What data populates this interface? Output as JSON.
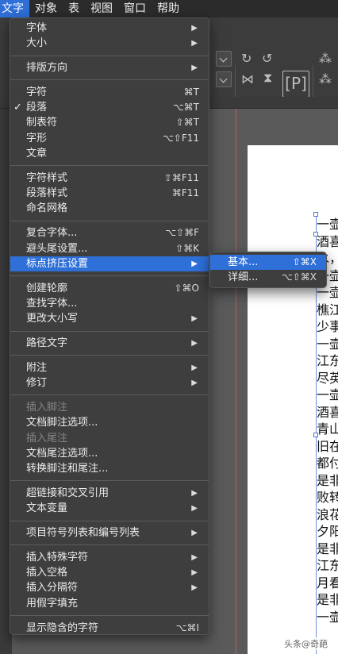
{
  "menubar": {
    "items": [
      {
        "label": "文字",
        "active": true
      },
      {
        "label": "对象",
        "active": false
      },
      {
        "label": "表",
        "active": false
      },
      {
        "label": "视图",
        "active": false
      },
      {
        "label": "窗口",
        "active": false
      },
      {
        "label": "帮助",
        "active": false
      }
    ]
  },
  "toolbar": {
    "bracket_glyph": "[P]"
  },
  "main_menu": {
    "items": {
      "font": {
        "label": "字体",
        "arrow": "▶"
      },
      "size": {
        "label": "大小",
        "arrow": "▶"
      },
      "orientation": {
        "label": "排版方向",
        "arrow": "▶"
      },
      "character": {
        "label": "字符",
        "shortcut": "⌘T"
      },
      "paragraph": {
        "label": "段落",
        "shortcut": "⌥⌘T",
        "check": "✓"
      },
      "tabs": {
        "label": "制表符",
        "shortcut": "⇧⌘T"
      },
      "glyphs": {
        "label": "字形",
        "shortcut": "⌥⇧F11"
      },
      "story": {
        "label": "文章"
      },
      "char_styles": {
        "label": "字符样式",
        "shortcut": "⇧⌘F11"
      },
      "para_styles": {
        "label": "段落样式",
        "shortcut": "⌘F11"
      },
      "named_grids": {
        "label": "命名网格"
      },
      "composite_fonts": {
        "label": "复合字体...",
        "shortcut": "⌥⇧⌘F"
      },
      "kinsoku": {
        "label": "避头尾设置...",
        "shortcut": "⇧⌘K"
      },
      "mojikumi": {
        "label": "标点挤压设置",
        "arrow": "▶"
      },
      "create_outlines": {
        "label": "创建轮廓",
        "shortcut": "⇧⌘O"
      },
      "find_font": {
        "label": "查找字体..."
      },
      "change_case": {
        "label": "更改大小写",
        "arrow": "▶"
      },
      "type_on_path": {
        "label": "路径文字",
        "arrow": "▶"
      },
      "notes": {
        "label": "附注",
        "arrow": "▶"
      },
      "track_changes": {
        "label": "修订",
        "arrow": "▶"
      },
      "insert_footnote": {
        "label": "插入脚注"
      },
      "footnote_options": {
        "label": "文档脚注选项..."
      },
      "insert_endnote": {
        "label": "插入尾注"
      },
      "endnote_options": {
        "label": "文档尾注选项..."
      },
      "convert_notes": {
        "label": "转换脚注和尾注..."
      },
      "hyperlinks": {
        "label": "超链接和交叉引用",
        "arrow": "▶"
      },
      "text_variables": {
        "label": "文本变量",
        "arrow": "▶"
      },
      "bullets_numbering": {
        "label": "项目符号列表和编号列表",
        "arrow": "▶"
      },
      "insert_special": {
        "label": "插入特殊字符",
        "arrow": "▶"
      },
      "insert_white": {
        "label": "插入空格",
        "arrow": "▶"
      },
      "insert_break": {
        "label": "插入分隔符",
        "arrow": "▶"
      },
      "fill_placeholder": {
        "label": "用假字填充"
      },
      "show_hidden": {
        "label": "显示隐含的字符",
        "shortcut": "⌥⌘I"
      }
    }
  },
  "sub_menu": {
    "items": {
      "basic": {
        "label": "基本...",
        "shortcut": "⇧⌘X"
      },
      "detailed": {
        "label": "详细...",
        "shortcut": "⌥⇧⌘X"
      }
    }
  },
  "document": {
    "lines": [
      "一壶",
      "酒喜",
      "水，",
      "一壶",
      "一壶",
      "樵江",
      "少事",
      "一壶",
      "江东",
      "尽英",
      "一壶",
      "酒喜",
      "青山",
      "旧在",
      "都付",
      "是非",
      "败转",
      "浪花",
      "夕阳",
      "是非",
      "江东",
      "月看",
      "是非",
      "一壶"
    ]
  },
  "watermark": "头条@奇葩"
}
